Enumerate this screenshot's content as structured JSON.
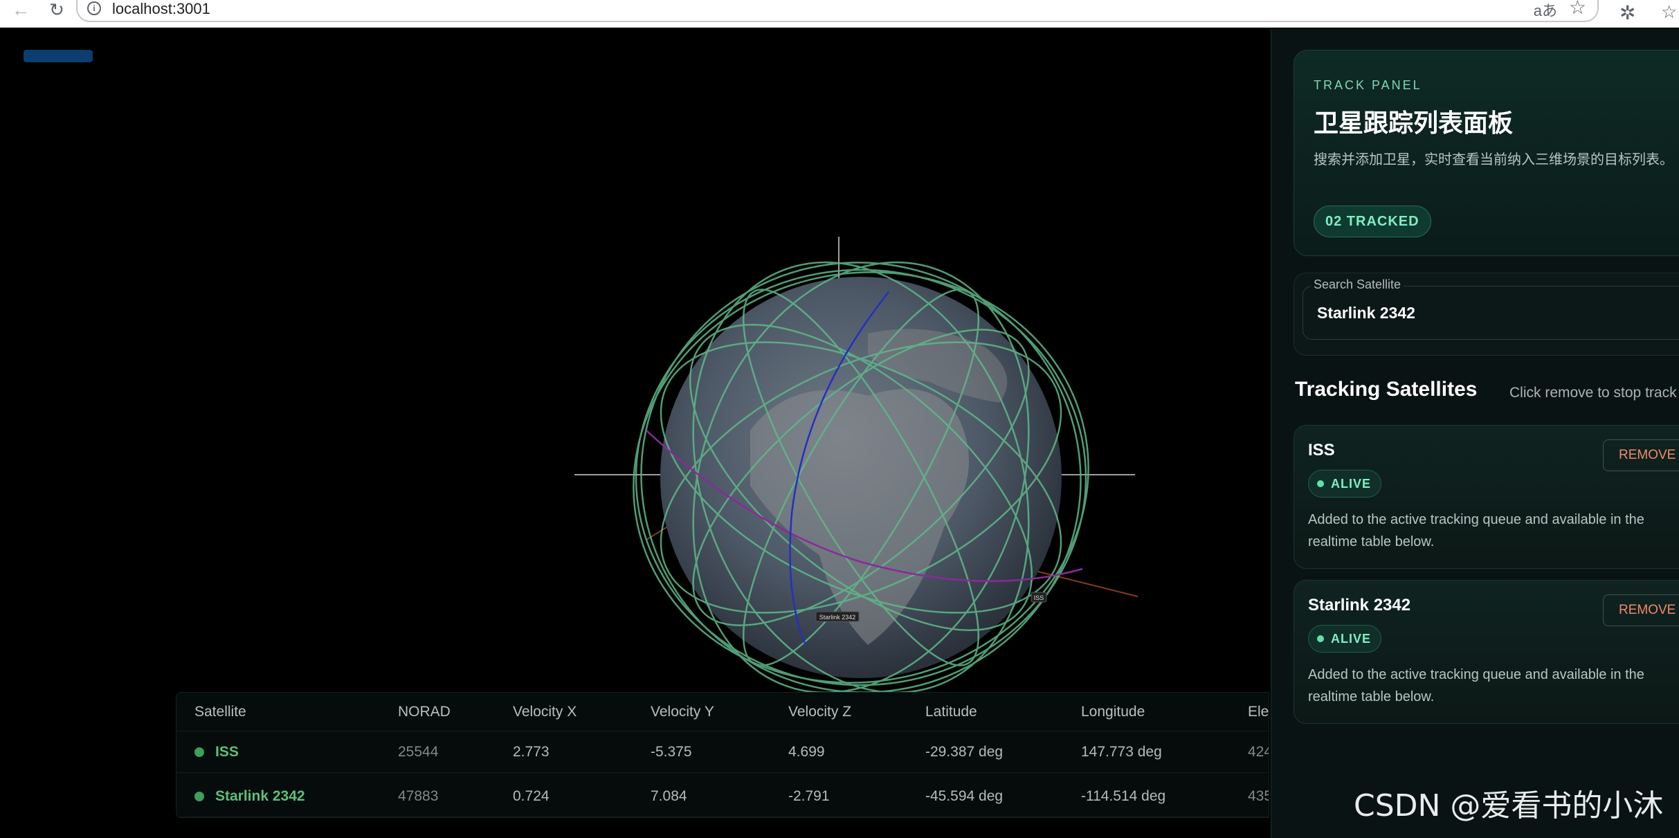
{
  "browser": {
    "url": "localhost:3001",
    "translate_glyph": "aあ",
    "star_glyph": "☆"
  },
  "globe": {
    "labels": [
      "Starlink 2342",
      "ISS"
    ]
  },
  "table": {
    "headers": [
      "Satellite",
      "NORAD",
      "Velocity X",
      "Velocity Y",
      "Velocity Z",
      "Latitude",
      "Longitude",
      "Elev"
    ],
    "rows": [
      {
        "name": "ISS",
        "norad": "25544",
        "vx": "2.773",
        "vy": "-5.375",
        "vz": "4.699",
        "lat": "-29.387 deg",
        "lon": "147.773 deg",
        "elev": "424"
      },
      {
        "name": "Starlink 2342",
        "norad": "47883",
        "vx": "0.724",
        "vy": "7.084",
        "vz": "-2.791",
        "lat": "-45.594 deg",
        "lon": "-114.514 deg",
        "elev": "435"
      }
    ]
  },
  "panel": {
    "kicker": "TRACK PANEL",
    "title": "卫星跟踪列表面板",
    "description": "搜索并添加卫星，实时查看当前纳入三维场景的目标列表。",
    "tracked_badge": "02 TRACKED",
    "search": {
      "label": "Search Satellite",
      "value": "Starlink 2342"
    },
    "tracking_title": "Tracking Satellites",
    "tracking_hint": "Click remove to stop track",
    "satellites": [
      {
        "name": "ISS",
        "status": "ALIVE",
        "remove_label": "REMOVE",
        "description": "Added to the active tracking queue and available in the realtime table below."
      },
      {
        "name": "Starlink 2342",
        "status": "ALIVE",
        "remove_label": "REMOVE",
        "description": "Added to the active tracking queue and available in the realtime table below."
      }
    ]
  },
  "watermark": "CSDN @爱看书的小沐",
  "colors": {
    "accent": "#7ff0c0",
    "remove": "#f08a6a",
    "orbit": "#5fb88a",
    "table_name": "#5bc07a"
  }
}
